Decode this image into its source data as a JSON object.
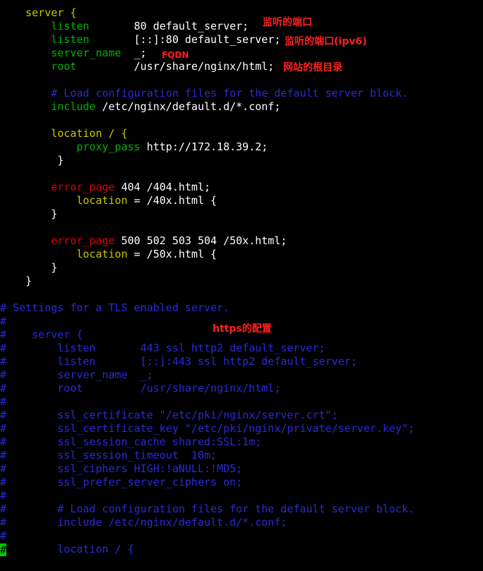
{
  "code_lines": [
    {
      "segments": [
        {
          "t": "    ",
          "c": "val"
        },
        {
          "t": "server {",
          "c": "kw"
        }
      ]
    },
    {
      "segments": [
        {
          "t": "        ",
          "c": "val"
        },
        {
          "t": "listen",
          "c": "dir"
        },
        {
          "t": "       80 default_server;",
          "c": "val"
        }
      ]
    },
    {
      "segments": [
        {
          "t": "        ",
          "c": "val"
        },
        {
          "t": "listen",
          "c": "dir"
        },
        {
          "t": "       [::]:80 default_server;",
          "c": "val"
        }
      ]
    },
    {
      "segments": [
        {
          "t": "        ",
          "c": "val"
        },
        {
          "t": "server_name",
          "c": "dir"
        },
        {
          "t": "  _;",
          "c": "val"
        }
      ]
    },
    {
      "segments": [
        {
          "t": "        ",
          "c": "val"
        },
        {
          "t": "root",
          "c": "dir"
        },
        {
          "t": "         /usr/share/nginx/html;",
          "c": "val"
        }
      ]
    },
    {
      "segments": []
    },
    {
      "segments": [
        {
          "t": "        # Load configuration files for the default server block.",
          "c": "cmt"
        }
      ]
    },
    {
      "segments": [
        {
          "t": "        ",
          "c": "val"
        },
        {
          "t": "include",
          "c": "dir"
        },
        {
          "t": " /etc/nginx/default.d/*.conf;",
          "c": "val"
        }
      ]
    },
    {
      "segments": []
    },
    {
      "segments": [
        {
          "t": "        ",
          "c": "val"
        },
        {
          "t": "location / {",
          "c": "kw"
        }
      ]
    },
    {
      "segments": [
        {
          "t": "            ",
          "c": "val"
        },
        {
          "t": "proxy_pass",
          "c": "dir"
        },
        {
          "t": " http://172.18.39.2;",
          "c": "val"
        }
      ]
    },
    {
      "segments": [
        {
          "t": "         }",
          "c": "val"
        }
      ]
    },
    {
      "segments": []
    },
    {
      "segments": [
        {
          "t": "        ",
          "c": "val"
        },
        {
          "t": "error_page",
          "c": "err"
        },
        {
          "t": " 404 /404.html;",
          "c": "val"
        }
      ]
    },
    {
      "segments": [
        {
          "t": "            ",
          "c": "val"
        },
        {
          "t": "location",
          "c": "kw"
        },
        {
          "t": " = /40x.html {",
          "c": "val"
        }
      ]
    },
    {
      "segments": [
        {
          "t": "        }",
          "c": "val"
        }
      ]
    },
    {
      "segments": []
    },
    {
      "segments": [
        {
          "t": "        ",
          "c": "val"
        },
        {
          "t": "error_page",
          "c": "err"
        },
        {
          "t": " 500 502 503 504 /50x.html;",
          "c": "val"
        }
      ]
    },
    {
      "segments": [
        {
          "t": "            ",
          "c": "val"
        },
        {
          "t": "location",
          "c": "kw"
        },
        {
          "t": " = /50x.html {",
          "c": "val"
        }
      ]
    },
    {
      "segments": [
        {
          "t": "        }",
          "c": "val"
        }
      ]
    },
    {
      "segments": [
        {
          "t": "    }",
          "c": "val"
        }
      ]
    },
    {
      "segments": []
    },
    {
      "segments": [
        {
          "t": "# Settings for a TLS enabled server.",
          "c": "cmt"
        }
      ]
    },
    {
      "segments": [
        {
          "t": "#",
          "c": "cmt"
        }
      ]
    },
    {
      "segments": [
        {
          "t": "#    server {",
          "c": "cmt"
        }
      ]
    },
    {
      "segments": [
        {
          "t": "#        listen       443 ssl http2 default_server;",
          "c": "cmt"
        }
      ]
    },
    {
      "segments": [
        {
          "t": "#        listen       [::]:443 ssl http2 default_server;",
          "c": "cmt"
        }
      ]
    },
    {
      "segments": [
        {
          "t": "#        server_name  _;",
          "c": "cmt"
        }
      ]
    },
    {
      "segments": [
        {
          "t": "#        root         /usr/share/nginx/html;",
          "c": "cmt"
        }
      ]
    },
    {
      "segments": [
        {
          "t": "#",
          "c": "cmt"
        }
      ]
    },
    {
      "segments": [
        {
          "t": "#        ssl_certificate \"/etc/pki/nginx/server.crt\";",
          "c": "cmt"
        }
      ]
    },
    {
      "segments": [
        {
          "t": "#        ssl_certificate_key \"/etc/pki/nginx/private/server.key\";",
          "c": "cmt"
        }
      ]
    },
    {
      "segments": [
        {
          "t": "#        ssl_session_cache shared:SSL:1m;",
          "c": "cmt"
        }
      ]
    },
    {
      "segments": [
        {
          "t": "#        ssl_session_timeout  10m;",
          "c": "cmt"
        }
      ]
    },
    {
      "segments": [
        {
          "t": "#        ssl_ciphers HIGH:!aNULL:!MD5;",
          "c": "cmt"
        }
      ]
    },
    {
      "segments": [
        {
          "t": "#        ssl_prefer_server_ciphers on;",
          "c": "cmt"
        }
      ]
    },
    {
      "segments": [
        {
          "t": "#",
          "c": "cmt"
        }
      ]
    },
    {
      "segments": [
        {
          "t": "#        # Load configuration files for the default server block.",
          "c": "cmt"
        }
      ]
    },
    {
      "segments": [
        {
          "t": "#        include /etc/nginx/default.d/*.conf;",
          "c": "cmt"
        }
      ]
    },
    {
      "segments": [
        {
          "t": "#",
          "c": "cmt"
        }
      ]
    },
    {
      "segments": [
        {
          "t": " ",
          "c": "val"
        },
        {
          "t": "        location / {",
          "c": "cmt"
        }
      ]
    }
  ],
  "cursor_char": "#",
  "annotations": {
    "listen_port": "监听的端口",
    "listen_port_ipv6": "监听的端口(ipv6)",
    "fqdn": "FQDN",
    "web_root": "网站的根目录",
    "https_config": "https的配置"
  },
  "colors": {
    "background": "#000000",
    "keyword": "#c8c800",
    "directive": "#00b300",
    "value": "#ffffff",
    "error_page": "#e00000",
    "comment": "#2a2ad8",
    "annotation": "#ff2020",
    "cursor": "#00cc00"
  }
}
